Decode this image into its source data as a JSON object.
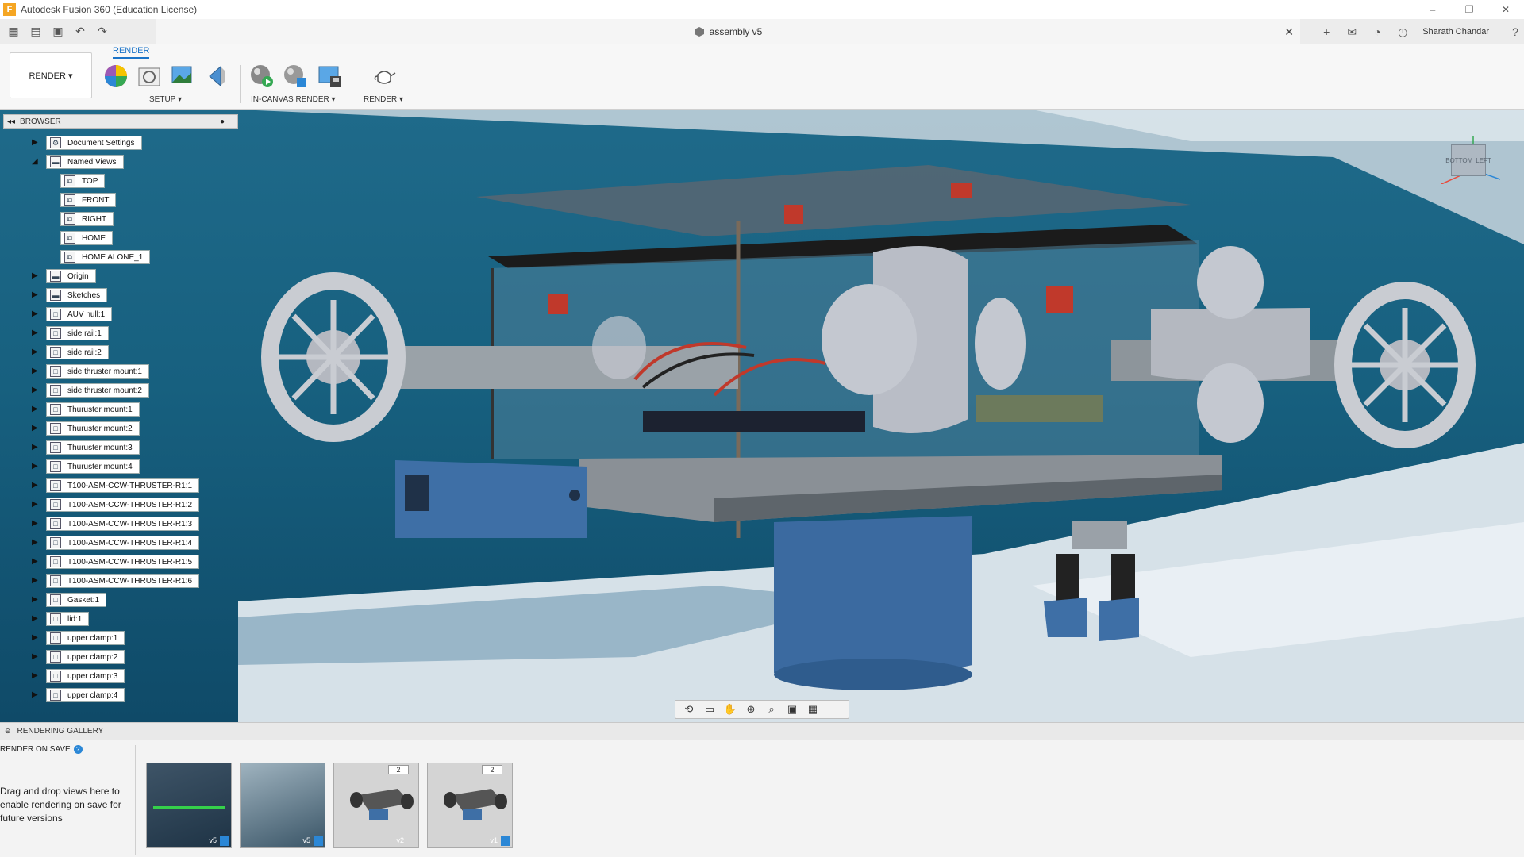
{
  "window": {
    "title": "Autodesk Fusion 360 (Education License)",
    "controls": [
      "–",
      "❐",
      "✕"
    ]
  },
  "document_tab": {
    "title": "assembly v5",
    "close": "✕"
  },
  "user": {
    "name": "Sharath Chandar"
  },
  "toolbar": {
    "workspace_tab": "RENDER",
    "workspace_switch": "RENDER ▾",
    "groups": {
      "setup": "SETUP ▾",
      "in_canvas_render": "IN-CANVAS RENDER ▾",
      "render": "RENDER ▾"
    }
  },
  "browser": {
    "header": "BROWSER",
    "items": [
      {
        "label": "Document Settings",
        "icon": "gear-icon",
        "expanded": false,
        "visible_toggle": false
      },
      {
        "label": "Named Views",
        "icon": "folder-icon",
        "expanded": true,
        "visible_toggle": false
      },
      {
        "label": "TOP",
        "icon": "named-view-icon",
        "child": true
      },
      {
        "label": "FRONT",
        "icon": "named-view-icon",
        "child": true
      },
      {
        "label": "RIGHT",
        "icon": "named-view-icon",
        "child": true
      },
      {
        "label": "HOME",
        "icon": "named-view-icon",
        "child": true
      },
      {
        "label": "HOME ALONE_1",
        "icon": "named-view-icon",
        "child": true
      },
      {
        "label": "Origin",
        "icon": "folder-icon"
      },
      {
        "label": "Sketches",
        "icon": "folder-icon"
      },
      {
        "label": "AUV hull:1",
        "icon": "component-icon"
      },
      {
        "label": "side rail:1",
        "icon": "component-icon"
      },
      {
        "label": "side rail:2",
        "icon": "component-icon"
      },
      {
        "label": "side thruster mount:1",
        "icon": "component-icon"
      },
      {
        "label": "side thruster mount:2",
        "icon": "component-icon"
      },
      {
        "label": "Thuruster mount:1",
        "icon": "component-icon"
      },
      {
        "label": "Thuruster mount:2",
        "icon": "component-icon"
      },
      {
        "label": "Thuruster mount:3",
        "icon": "component-icon"
      },
      {
        "label": "Thuruster mount:4",
        "icon": "component-icon"
      },
      {
        "label": "T100-ASM-CCW-THRUSTER-R1:1",
        "icon": "component-icon"
      },
      {
        "label": "T100-ASM-CCW-THRUSTER-R1:2",
        "icon": "component-icon"
      },
      {
        "label": "T100-ASM-CCW-THRUSTER-R1:3",
        "icon": "component-icon"
      },
      {
        "label": "T100-ASM-CCW-THRUSTER-R1:4",
        "icon": "component-icon"
      },
      {
        "label": "T100-ASM-CCW-THRUSTER-R1:5",
        "icon": "component-icon"
      },
      {
        "label": "T100-ASM-CCW-THRUSTER-R1:6",
        "icon": "component-icon"
      },
      {
        "label": "Gasket:1",
        "icon": "component-icon"
      },
      {
        "label": "lid:1",
        "icon": "component-icon"
      },
      {
        "label": "upper clamp:1",
        "icon": "component-icon"
      },
      {
        "label": "upper clamp:2",
        "icon": "component-icon"
      },
      {
        "label": "upper clamp:3",
        "icon": "component-icon"
      },
      {
        "label": "upper clamp:4",
        "icon": "component-icon"
      }
    ]
  },
  "viewcube": {
    "face_left": "LEFT",
    "face_bottom": "BOTTOM"
  },
  "gallery": {
    "header": "RENDERING GALLERY",
    "render_on_save": "RENDER ON SAVE",
    "help": "?",
    "drop_hint": "Drag and drop views here to enable rendering on save for future versions",
    "thumbnails": [
      {
        "label": "v5",
        "badge": ""
      },
      {
        "label": "v5",
        "badge": ""
      },
      {
        "label": "v2",
        "badge": "2"
      },
      {
        "label": "v1",
        "badge": "2"
      }
    ]
  },
  "colors": {
    "accent": "#1a73c8",
    "viewport_water": "#17607f",
    "floor": "#d8e3ea",
    "hull_blue": "#3e6fa6"
  }
}
